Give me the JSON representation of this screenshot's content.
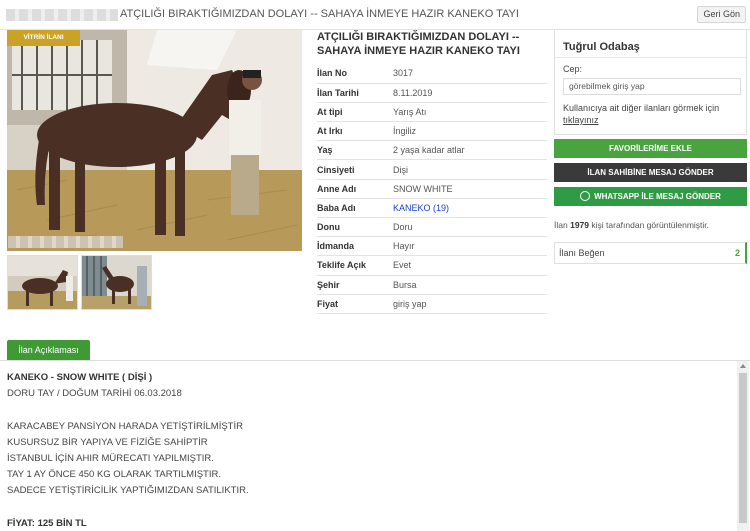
{
  "header": {
    "title": "ATÇILIĞI BIRAKTIĞIMIZDAN DOLAYI -- SAHAYA İNMEYE HAZIR KANEKO TAYI",
    "back_label": "Geri Gön"
  },
  "listing": {
    "badge": "VİTRİN İLANI",
    "title": "ATÇILIĞI BIRAKTIĞIMIZDAN DOLAYI -- SAHAYA İNMEYE HAZIR KANEKO TAYI",
    "details": [
      {
        "key": "İlan No",
        "value": "3017"
      },
      {
        "key": "İlan Tarihi",
        "value": "8.11.2019"
      },
      {
        "key": "At tipi",
        "value": "Yarış Atı"
      },
      {
        "key": "At Irkı",
        "value": "İngiliz"
      },
      {
        "key": "Yaş",
        "value": "2 yaşa kadar atlar"
      },
      {
        "key": "Cinsiyeti",
        "value": "Dişi"
      },
      {
        "key": "Anne Adı",
        "value": "SNOW WHITE"
      },
      {
        "key": "Baba Adı",
        "value": "KANEKO (19)"
      },
      {
        "key": "Donu",
        "value": "Doru"
      },
      {
        "key": "İdmanda",
        "value": "Hayır"
      },
      {
        "key": "Teklife Açık",
        "value": "Evet"
      },
      {
        "key": "Şehir",
        "value": "Bursa"
      },
      {
        "key": "Fiyat",
        "value": "giriş yap"
      }
    ]
  },
  "seller": {
    "name": "Tuğrul Odabaş",
    "phone_label": "Cep:",
    "phone_value": "görebilmek giriş yap",
    "other_ads_text": "Kullanıcıya ait diğer ilanları görmek için",
    "other_ads_link": "tıklayınız"
  },
  "actions": {
    "favorite": "FAVORİLERİME EKLE",
    "message": "İLAN SAHİBİNE MESAJ GÖNDER",
    "whatsapp": "WHATSAPP İLE MESAJ GÖNDER"
  },
  "stats": {
    "views_prefix": "İlan",
    "views_count": "1979",
    "views_suffix": "kişi tarafından görüntülenmiştir.",
    "like_label": "İlanı Beğen",
    "like_count": "2"
  },
  "description": {
    "tab_label": "İlan Açıklaması",
    "heading": "KANEKO - SNOW WHITE ( DİŞİ )",
    "line1": "DORU TAY / DOĞUM TARİHİ 06.03.2018",
    "body": [
      "KARACABEY PANSİYON HARADA YETİŞTİRİLMİŞTİR",
      "KUSURSUZ BİR YAPIYA VE FİZİĞE SAHİPTİR",
      "İSTANBUL İÇİN AHIR MÜRECATI YAPILMIŞTIR.",
      "TAY 1 AY ÖNCE 450 KG OLARAK TARTILMIŞTIR.",
      "SADECE YETİŞTİRİCİLİK YAPTIĞIMIZDAN SATILIKTIR."
    ],
    "price": "FİYAT: 125 BİN TL"
  },
  "colors": {
    "green": "#49a33e",
    "dark": "#3a3a3a",
    "gold": "#c9a227",
    "link": "#1a3ed6"
  }
}
